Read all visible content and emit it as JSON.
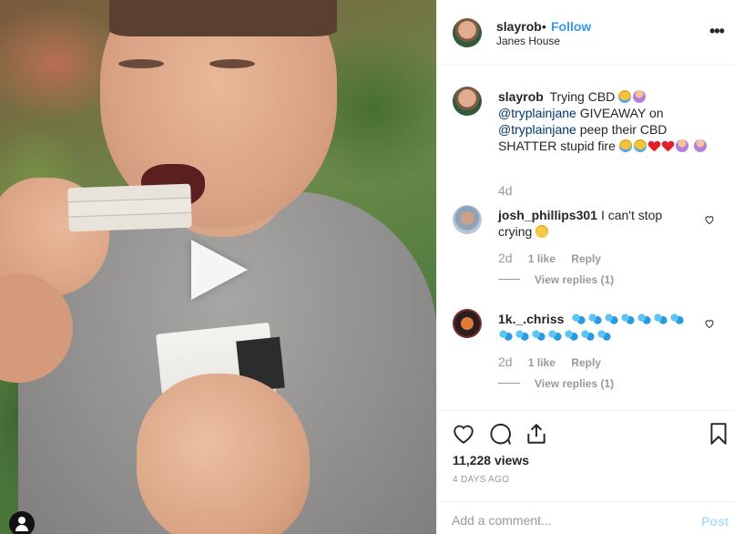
{
  "post": {
    "owner": "slayrob",
    "separator": "•",
    "follow_label": "Follow",
    "location": "Janes House",
    "more_label": "•••"
  },
  "caption": {
    "username": "slayrob",
    "part1": "Trying CBD",
    "mention1": "@tryplainjane",
    "part2": "GIVEAWAY on",
    "mention2": "@tryplainjane",
    "part3": "peep their CBD SHATTER stupid fire",
    "age": "4d",
    "emoji_colors": {
      "heart": "#e0202a",
      "mention": "#003569"
    }
  },
  "comments": [
    {
      "username": "josh_phillips301",
      "text": "I can't stop crying",
      "age": "2d",
      "likes": "1 like",
      "reply_label": "Reply",
      "view_replies": "View replies (1)"
    },
    {
      "username": "1k._.chriss",
      "text": "",
      "age": "2d",
      "likes": "1 like",
      "reply_label": "Reply",
      "view_replies": "View replies (1)"
    }
  ],
  "stats": {
    "views": "11,228 views",
    "posted": "4 DAYS AGO"
  },
  "composer": {
    "placeholder": "Add a comment...",
    "post_label": "Post"
  },
  "colors": {
    "accent": "#3897f0",
    "muted": "#999999",
    "border": "#efefef",
    "post_disabled": "#b2dffc"
  },
  "icons": [
    "play-icon",
    "tag-user-icon",
    "more-icon",
    "like-heart-icon",
    "comment-icon",
    "share-icon",
    "bookmark-icon"
  ]
}
